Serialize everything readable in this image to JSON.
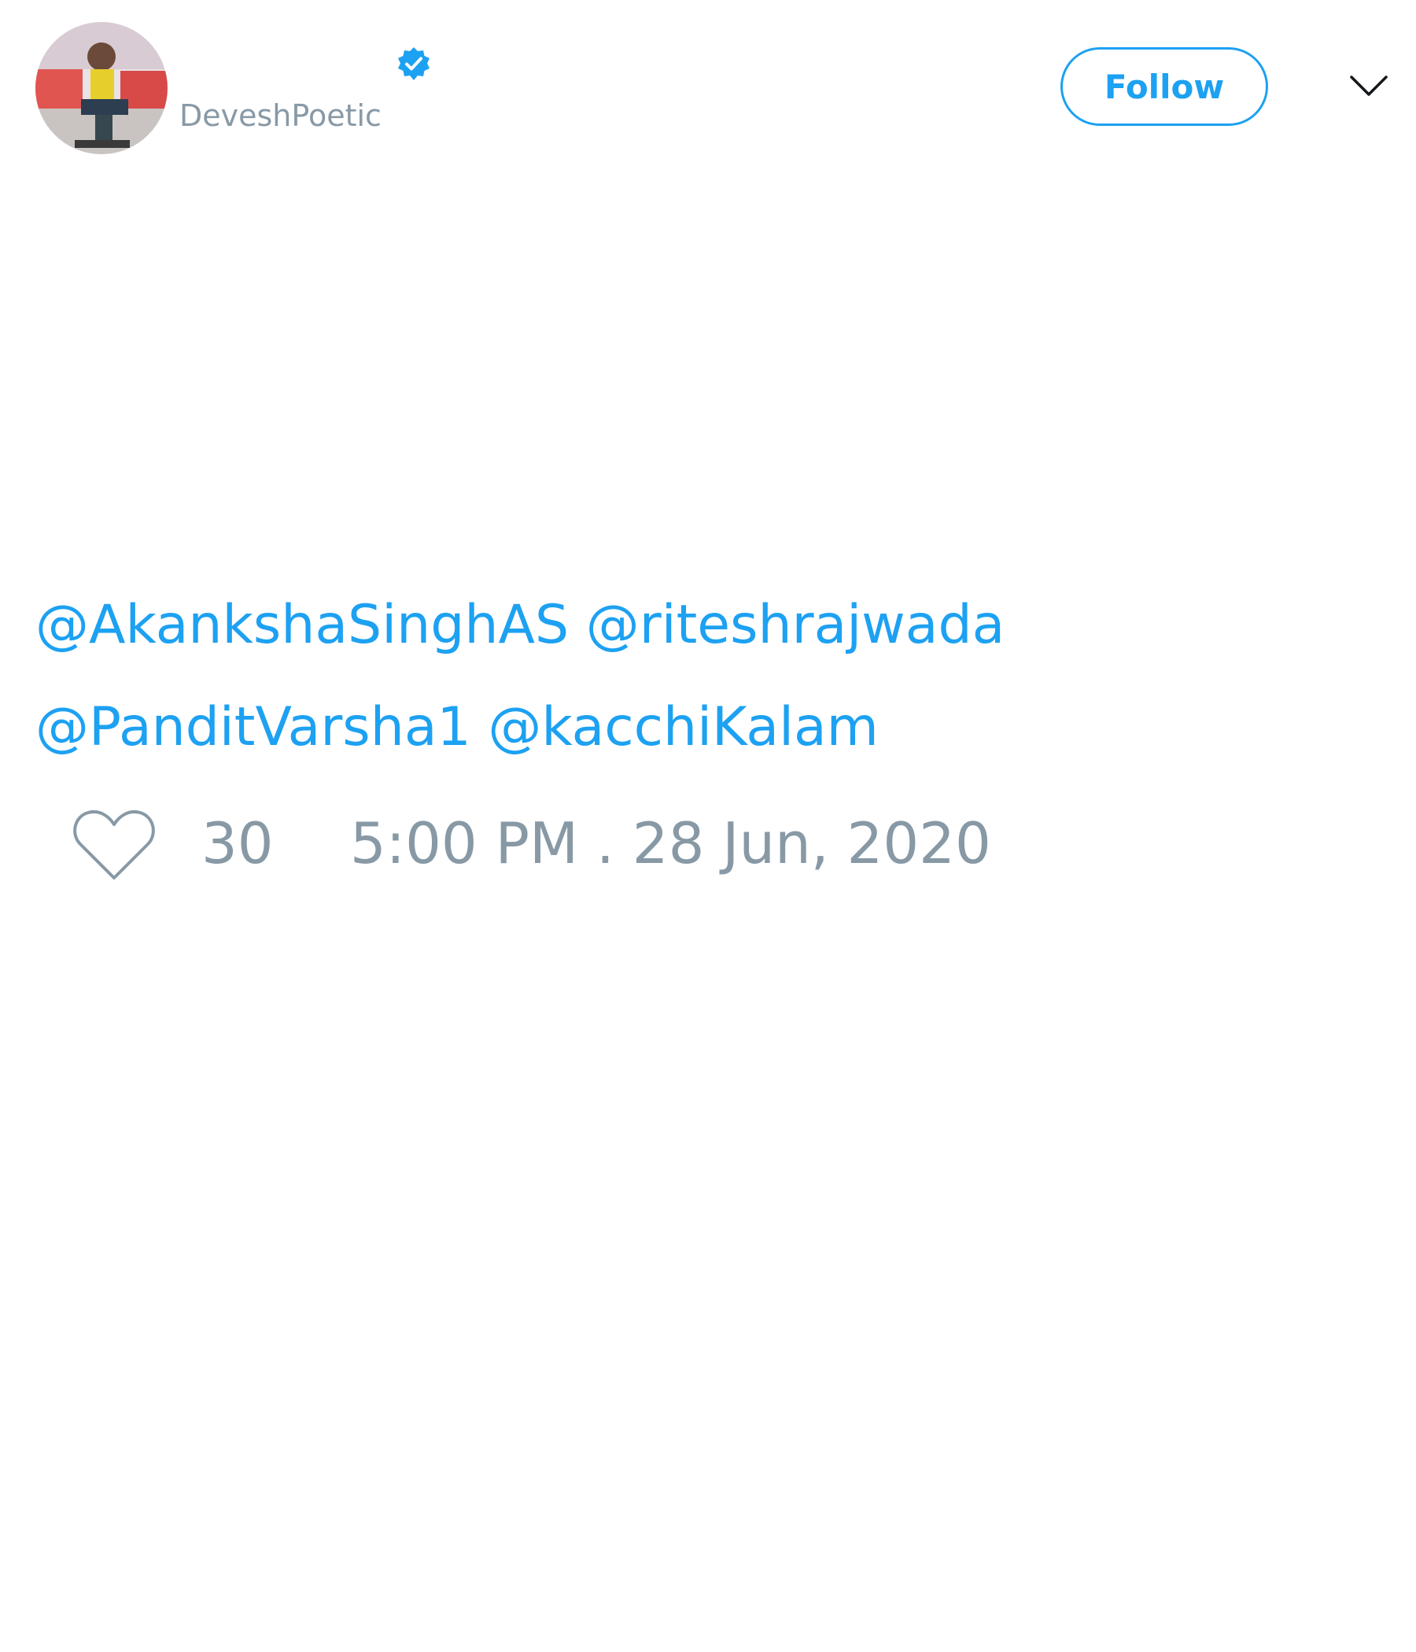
{
  "author": {
    "display_name": "",
    "username": "DeveshPoetic",
    "verified": true,
    "avatar": "profile-photo"
  },
  "header": {
    "follow_label": "Follow",
    "more_icon": "chevron-down-icon"
  },
  "tweet": {
    "mentions": [
      "@AkankshaSinghAS",
      "@riteshrajwada",
      "@PanditVarsha1",
      "@kacchiKalam"
    ]
  },
  "footer": {
    "like_icon": "heart-icon",
    "like_count": "30",
    "timestamp": "5:00 PM . 28 Jun, 2020"
  },
  "colors": {
    "accent": "#1da1f2",
    "muted": "#8899a6",
    "background": "#ffffff"
  }
}
